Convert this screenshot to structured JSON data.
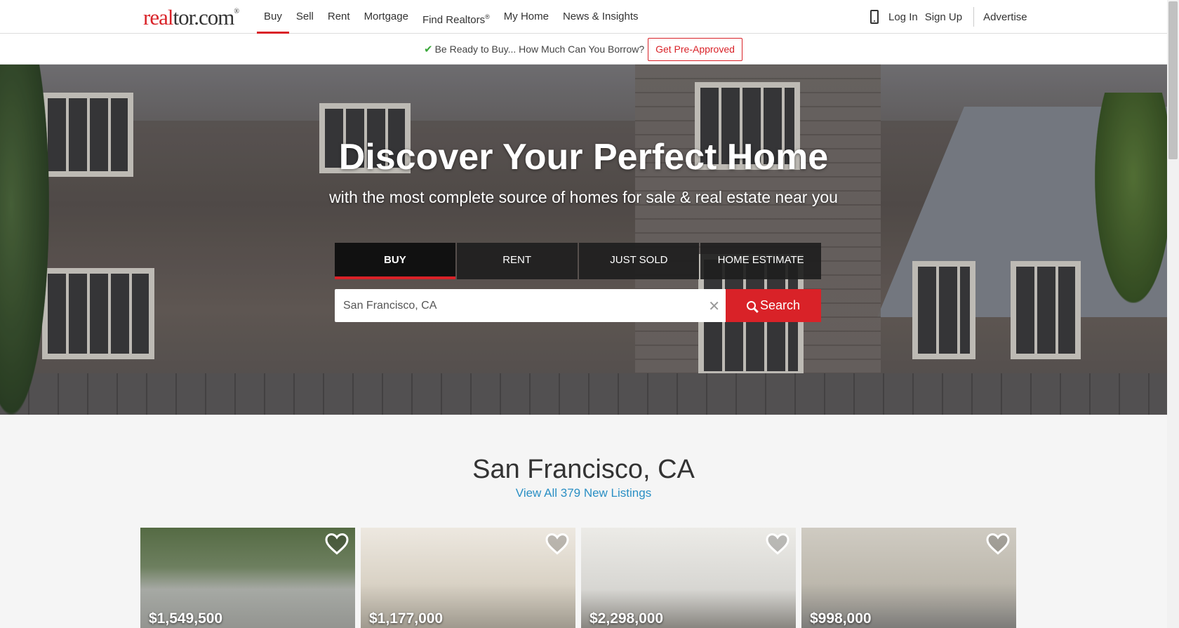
{
  "header": {
    "logo_real": "real",
    "logo_rest": "tor.com",
    "logo_reg": "®",
    "nav": [
      {
        "label": "Buy"
      },
      {
        "label": "Sell"
      },
      {
        "label": "Rent"
      },
      {
        "label": "Mortgage"
      },
      {
        "label": "Find Realtors",
        "sup": "®"
      },
      {
        "label": "My Home"
      },
      {
        "label": "News & Insights"
      }
    ],
    "login": "Log In",
    "signup": "Sign Up",
    "advertise": "Advertise"
  },
  "promo": {
    "text": "Be Ready to Buy... How Much Can You Borrow?",
    "button": "Get Pre-Approved"
  },
  "hero": {
    "title": "Discover Your Perfect Home",
    "subtitle": "with the most complete source of homes for sale & real estate near you",
    "tabs": [
      "BUY",
      "RENT",
      "JUST SOLD",
      "HOME ESTIMATE"
    ],
    "search_value": "San Francisco, CA",
    "search_button": "Search"
  },
  "listings": {
    "city": "San Francisco, CA",
    "view_all": "View All 379 New Listings",
    "prices": [
      "$1,549,500",
      "$1,177,000",
      "$2,298,000",
      "$998,000"
    ]
  },
  "colors": {
    "brand": "#d92228",
    "link": "#2a8fc4"
  }
}
